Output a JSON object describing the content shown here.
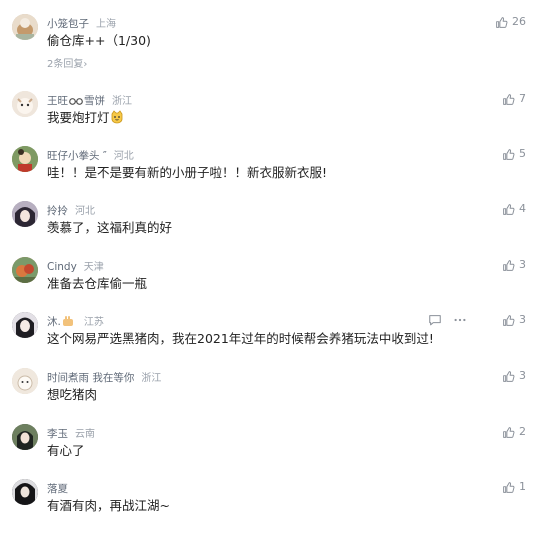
{
  "comments": [
    {
      "name": "小笼包子",
      "location": "上海",
      "text": "偷仓库++（1/30)",
      "likes": "26",
      "replies": "2条回复›",
      "avatar_color": "#c9b59d"
    },
    {
      "name": "王旺",
      "name_suffix": "雪饼",
      "location": "浙江",
      "text": "我要炮打灯",
      "likes": "7",
      "avatar_color": "#e6d7cb"
    },
    {
      "name": "旺仔小拳头 ″",
      "location": "河北",
      "text": "哇！！是不是要有新的小册子啦！！新衣服新衣服!",
      "likes": "5",
      "avatar_color": "#6f8f5b"
    },
    {
      "name": "拎拎",
      "location": "河北",
      "text": "羡慕了，这福利真的好",
      "likes": "4",
      "avatar_color": "#8a8296"
    },
    {
      "name": "Cindy",
      "location": "天津",
      "text": "准备去仓库偷一瓶",
      "likes": "3",
      "avatar_color": "#b86b4a"
    },
    {
      "name": "沐.",
      "location": "江苏",
      "text": "这个网易严选黑猪肉，我在2021年过年的时候帮会养猪玩法中收到过!",
      "likes": "3",
      "avatar_color": "#4a4a52"
    },
    {
      "name": "时间煮雨 我在等你",
      "location": "浙江",
      "text": "想吃猪肉",
      "likes": "3",
      "avatar_color": "#d8c9ba"
    },
    {
      "name": "李玉",
      "location": "云南",
      "text": "有心了",
      "likes": "2",
      "avatar_color": "#3e4a3a"
    },
    {
      "name": "落夏",
      "location": "",
      "text": "有酒有肉，再战江湖~",
      "likes": "1",
      "avatar_color": "#2e2e33"
    }
  ]
}
